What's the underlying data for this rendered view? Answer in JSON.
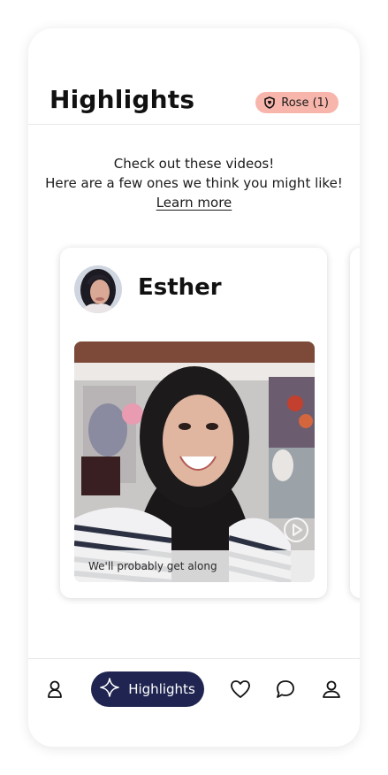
{
  "header": {
    "title": "Highlights",
    "rose_badge": {
      "label": "Rose (1)",
      "icon": "rose-shield-icon",
      "color": "#f7b5ab"
    }
  },
  "intro": {
    "line1": "Check out these videos!",
    "line2": "Here are a few ones we think you might like!",
    "learn_more": "Learn more"
  },
  "card": {
    "name": "Esther",
    "avatar": "profile-photo",
    "video_caption": "We'll probably get along",
    "play_icon": "play-circle-icon"
  },
  "bottom_nav": {
    "items": [
      {
        "name": "discover",
        "icon": "person-outline-icon"
      },
      {
        "name": "highlights",
        "icon": "sparkle-icon",
        "label": "Highlights",
        "active": true
      },
      {
        "name": "likes",
        "icon": "heart-icon"
      },
      {
        "name": "messages",
        "icon": "chat-bubble-icon"
      },
      {
        "name": "profile",
        "icon": "user-icon"
      }
    ],
    "active_color": "#1f2550"
  }
}
